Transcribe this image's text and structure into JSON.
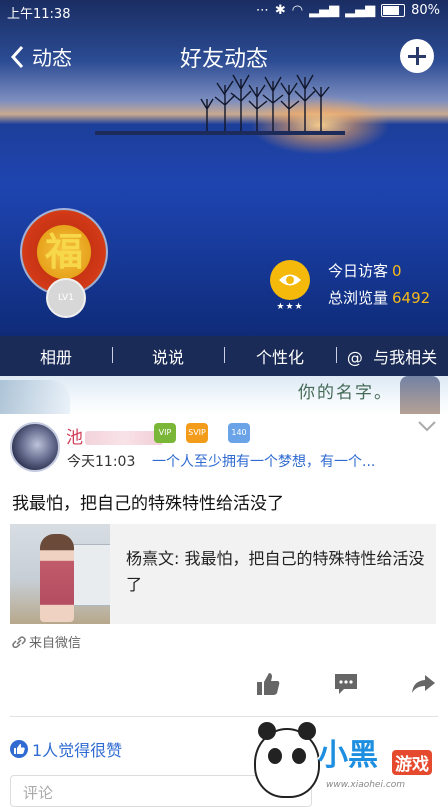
{
  "status_bar": {
    "time": "上午11:38",
    "battery": "80%"
  },
  "nav": {
    "back_label": "动态",
    "title": "好友动态"
  },
  "profile": {
    "avatar_glyph": "福",
    "level_badge": "LV1",
    "visitors_label": "今日访客",
    "visitors_value": "0",
    "views_label": "总浏览量",
    "views_value": "6492",
    "eye_stars": "★★★"
  },
  "tabs": [
    {
      "label": "相册"
    },
    {
      "label": "说说"
    },
    {
      "label": "个性化"
    },
    {
      "label": "与我相关",
      "prefix": "@"
    }
  ],
  "strip": {
    "text": "你的名字。"
  },
  "post": {
    "author_visible": "池",
    "badges": [
      "VIP",
      "SVIP",
      "140"
    ],
    "time": "今天11:03",
    "signature": "一个人至少拥有一个梦想，有一个...",
    "text": "我最怕，把自己的特殊特性给活没了",
    "share": {
      "text": "杨熹文: 我最怕，把自己的特殊特性给活没了"
    },
    "source": "来自微信",
    "likes_text": "1人觉得很赞",
    "comment_placeholder": "评论"
  },
  "watermark": {
    "title": "小黑",
    "game": "游戏",
    "url": "www.xiaohei.com"
  },
  "colors": {
    "tab_bar": "#1b2b57",
    "accent_link": "#2f6bd1",
    "stat_number": "#f6b91a",
    "name": "#d0405a"
  }
}
